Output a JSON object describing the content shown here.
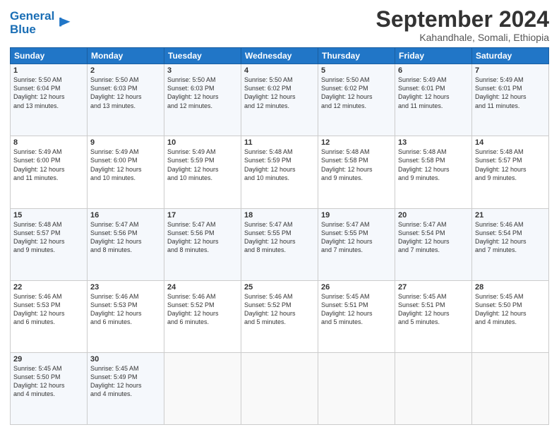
{
  "logo": {
    "line1": "General",
    "line2": "Blue"
  },
  "title": "September 2024",
  "subtitle": "Kahandhale, Somali, Ethiopia",
  "header_days": [
    "Sunday",
    "Monday",
    "Tuesday",
    "Wednesday",
    "Thursday",
    "Friday",
    "Saturday"
  ],
  "weeks": [
    [
      {
        "day": "1",
        "info": "Sunrise: 5:50 AM\nSunset: 6:04 PM\nDaylight: 12 hours\nand 13 minutes."
      },
      {
        "day": "2",
        "info": "Sunrise: 5:50 AM\nSunset: 6:03 PM\nDaylight: 12 hours\nand 13 minutes."
      },
      {
        "day": "3",
        "info": "Sunrise: 5:50 AM\nSunset: 6:03 PM\nDaylight: 12 hours\nand 12 minutes."
      },
      {
        "day": "4",
        "info": "Sunrise: 5:50 AM\nSunset: 6:02 PM\nDaylight: 12 hours\nand 12 minutes."
      },
      {
        "day": "5",
        "info": "Sunrise: 5:50 AM\nSunset: 6:02 PM\nDaylight: 12 hours\nand 12 minutes."
      },
      {
        "day": "6",
        "info": "Sunrise: 5:49 AM\nSunset: 6:01 PM\nDaylight: 12 hours\nand 11 minutes."
      },
      {
        "day": "7",
        "info": "Sunrise: 5:49 AM\nSunset: 6:01 PM\nDaylight: 12 hours\nand 11 minutes."
      }
    ],
    [
      {
        "day": "8",
        "info": "Sunrise: 5:49 AM\nSunset: 6:00 PM\nDaylight: 12 hours\nand 11 minutes."
      },
      {
        "day": "9",
        "info": "Sunrise: 5:49 AM\nSunset: 6:00 PM\nDaylight: 12 hours\nand 10 minutes."
      },
      {
        "day": "10",
        "info": "Sunrise: 5:49 AM\nSunset: 5:59 PM\nDaylight: 12 hours\nand 10 minutes."
      },
      {
        "day": "11",
        "info": "Sunrise: 5:48 AM\nSunset: 5:59 PM\nDaylight: 12 hours\nand 10 minutes."
      },
      {
        "day": "12",
        "info": "Sunrise: 5:48 AM\nSunset: 5:58 PM\nDaylight: 12 hours\nand 9 minutes."
      },
      {
        "day": "13",
        "info": "Sunrise: 5:48 AM\nSunset: 5:58 PM\nDaylight: 12 hours\nand 9 minutes."
      },
      {
        "day": "14",
        "info": "Sunrise: 5:48 AM\nSunset: 5:57 PM\nDaylight: 12 hours\nand 9 minutes."
      }
    ],
    [
      {
        "day": "15",
        "info": "Sunrise: 5:48 AM\nSunset: 5:57 PM\nDaylight: 12 hours\nand 9 minutes."
      },
      {
        "day": "16",
        "info": "Sunrise: 5:47 AM\nSunset: 5:56 PM\nDaylight: 12 hours\nand 8 minutes."
      },
      {
        "day": "17",
        "info": "Sunrise: 5:47 AM\nSunset: 5:56 PM\nDaylight: 12 hours\nand 8 minutes."
      },
      {
        "day": "18",
        "info": "Sunrise: 5:47 AM\nSunset: 5:55 PM\nDaylight: 12 hours\nand 8 minutes."
      },
      {
        "day": "19",
        "info": "Sunrise: 5:47 AM\nSunset: 5:55 PM\nDaylight: 12 hours\nand 7 minutes."
      },
      {
        "day": "20",
        "info": "Sunrise: 5:47 AM\nSunset: 5:54 PM\nDaylight: 12 hours\nand 7 minutes."
      },
      {
        "day": "21",
        "info": "Sunrise: 5:46 AM\nSunset: 5:54 PM\nDaylight: 12 hours\nand 7 minutes."
      }
    ],
    [
      {
        "day": "22",
        "info": "Sunrise: 5:46 AM\nSunset: 5:53 PM\nDaylight: 12 hours\nand 6 minutes."
      },
      {
        "day": "23",
        "info": "Sunrise: 5:46 AM\nSunset: 5:53 PM\nDaylight: 12 hours\nand 6 minutes."
      },
      {
        "day": "24",
        "info": "Sunrise: 5:46 AM\nSunset: 5:52 PM\nDaylight: 12 hours\nand 6 minutes."
      },
      {
        "day": "25",
        "info": "Sunrise: 5:46 AM\nSunset: 5:52 PM\nDaylight: 12 hours\nand 5 minutes."
      },
      {
        "day": "26",
        "info": "Sunrise: 5:45 AM\nSunset: 5:51 PM\nDaylight: 12 hours\nand 5 minutes."
      },
      {
        "day": "27",
        "info": "Sunrise: 5:45 AM\nSunset: 5:51 PM\nDaylight: 12 hours\nand 5 minutes."
      },
      {
        "day": "28",
        "info": "Sunrise: 5:45 AM\nSunset: 5:50 PM\nDaylight: 12 hours\nand 4 minutes."
      }
    ],
    [
      {
        "day": "29",
        "info": "Sunrise: 5:45 AM\nSunset: 5:50 PM\nDaylight: 12 hours\nand 4 minutes."
      },
      {
        "day": "30",
        "info": "Sunrise: 5:45 AM\nSunset: 5:49 PM\nDaylight: 12 hours\nand 4 minutes."
      },
      {
        "day": "",
        "info": ""
      },
      {
        "day": "",
        "info": ""
      },
      {
        "day": "",
        "info": ""
      },
      {
        "day": "",
        "info": ""
      },
      {
        "day": "",
        "info": ""
      }
    ]
  ]
}
